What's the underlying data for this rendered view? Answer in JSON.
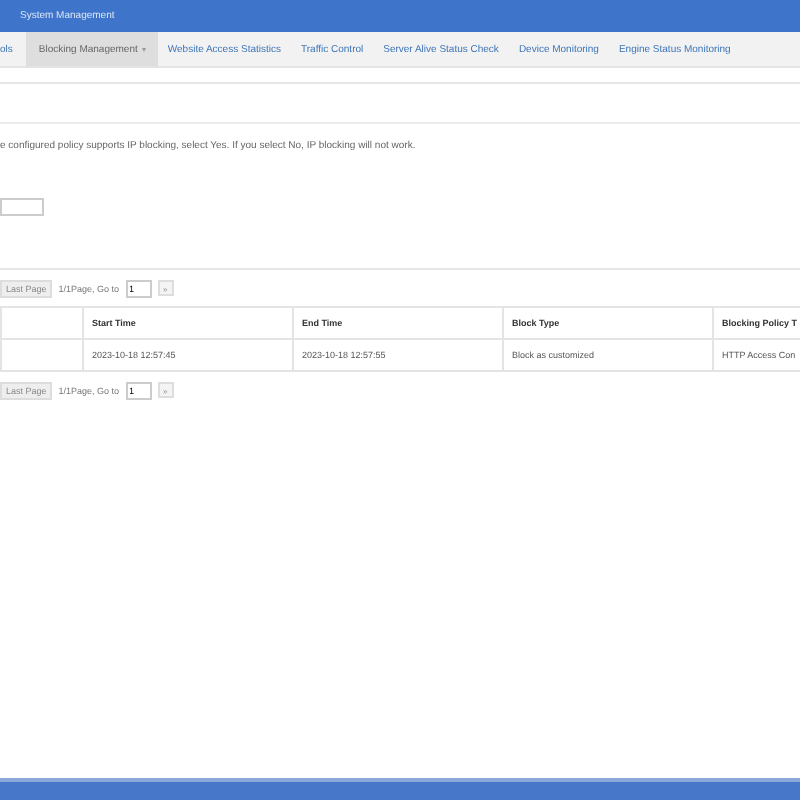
{
  "header": {
    "title": "System Management"
  },
  "tabs": [
    {
      "label": "ols",
      "selected": false,
      "dropdown": false
    },
    {
      "label": "Blocking Management",
      "selected": true,
      "dropdown": true
    },
    {
      "label": "Website Access Statistics",
      "selected": false,
      "dropdown": false
    },
    {
      "label": "Traffic Control",
      "selected": false,
      "dropdown": false
    },
    {
      "label": "Server Alive Status Check",
      "selected": false,
      "dropdown": false
    },
    {
      "label": "Device Monitoring",
      "selected": false,
      "dropdown": false
    },
    {
      "label": "Engine Status Monitoring",
      "selected": false,
      "dropdown": false
    }
  ],
  "hint": "e configured policy supports IP blocking, select Yes. If you select No, IP blocking will not work.",
  "pagination_top": {
    "last_page": "Last Page",
    "last_page_disabled": true,
    "info": "1/1Page, Go to",
    "page": "1",
    "go": "»"
  },
  "table": {
    "columns": [
      "",
      "Start Time",
      "End Time",
      "Block Type",
      "Blocking Policy T"
    ],
    "rows": [
      [
        "",
        "2023-10-18 12:57:45",
        "2023-10-18 12:57:55",
        "Block as customized",
        "HTTP Access Con"
      ]
    ]
  },
  "pagination_bottom": {
    "last_page": "Last Page",
    "last_page_disabled": true,
    "info": "1/1Page, Go to",
    "page": "1",
    "go": "»"
  }
}
